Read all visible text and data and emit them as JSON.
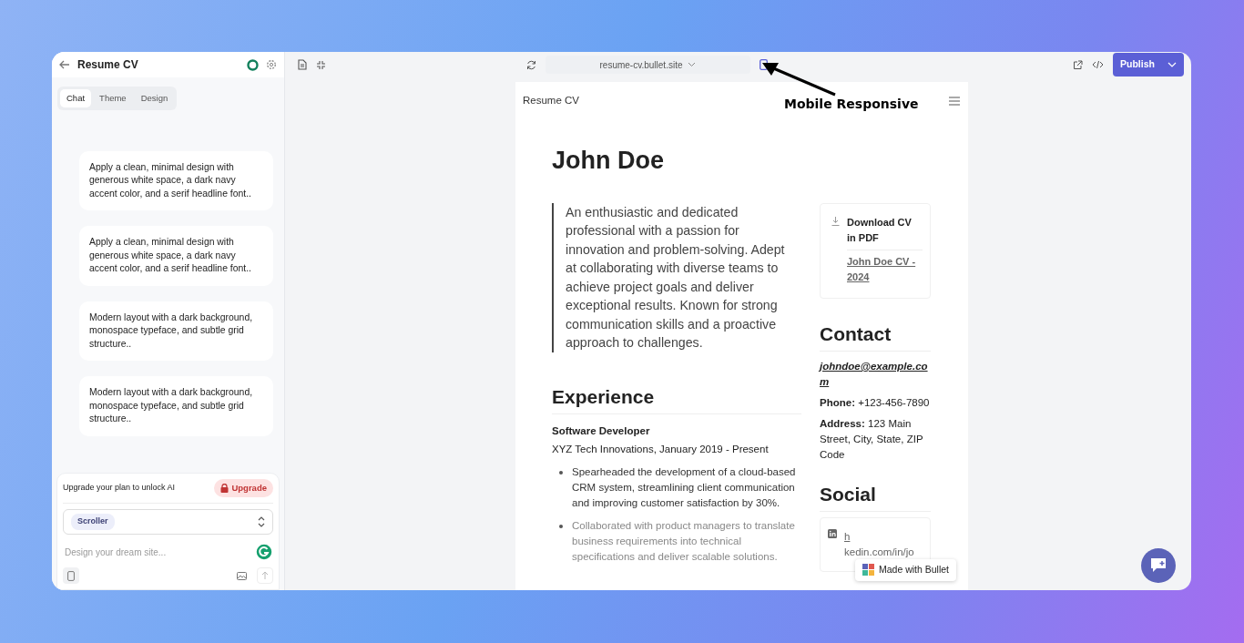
{
  "sidebar": {
    "title": "Resume CV",
    "status_on": true,
    "tabs": [
      {
        "label": "Chat",
        "selected": true
      },
      {
        "label": "Theme",
        "selected": false
      },
      {
        "label": "Design",
        "selected": false
      }
    ],
    "messages": [
      {
        "text": "Apply a clean, minimal design with generous white space, a dark navy accent color, and a serif headline font.."
      },
      {
        "text": "Apply a clean, minimal design with generous white space, a dark navy accent color, and a serif headline font.."
      },
      {
        "text": "Modern layout with a dark background, monospace typeface, and subtle grid structure.."
      },
      {
        "text": "Modern layout with a dark background, monospace typeface, and subtle grid structure.."
      }
    ],
    "upgrade_note": "Upgrade your plan to unlock AI",
    "upgrade_button": "Upgrade",
    "select_value": "Scroller",
    "prompt": {
      "placeholder": "Design your dream site..."
    }
  },
  "toolbar": {
    "url": "resume-cv.bullet.site",
    "publish": "Publish"
  },
  "annotation": "Mobile Responsive",
  "preview": {
    "site_title": "Resume CV",
    "name": "John Doe",
    "summary": "An enthusiastic and dedicated professional with a passion for innovation and problem-solving. Adept at collaborating with diverse teams to achieve project goals and deliver exceptional results. Known for strong communication skills and a proactive approach to challenges.",
    "experience_heading": "Experience",
    "job_title": "Software Developer",
    "job_meta": "XYZ Tech Innovations, January 2019 - Present",
    "bullets": [
      {
        "text": "Spearheaded the development of a cloud-based CRM system, streamlining client communication and improving customer satisfaction by 30%.",
        "muted": false
      },
      {
        "text": "Collaborated with product managers to translate business requirements into technical specifications and deliver scalable solutions.",
        "muted": true
      }
    ],
    "download": {
      "title": "Download CV in PDF",
      "link": "John Doe CV - 2024"
    },
    "contact_heading": "Contact",
    "email": "johndoe@example.com",
    "contact_lines": [
      {
        "label": "Phone:",
        "value": "+123-456-7890"
      },
      {
        "label": "Address:",
        "value": "123 Main Street, City, State, ZIP Code"
      }
    ],
    "social_heading": "Social",
    "social_link_start": "h",
    "social_link_rest": "kedin.com/in/jo"
  },
  "badge": "Made with Bullet"
}
